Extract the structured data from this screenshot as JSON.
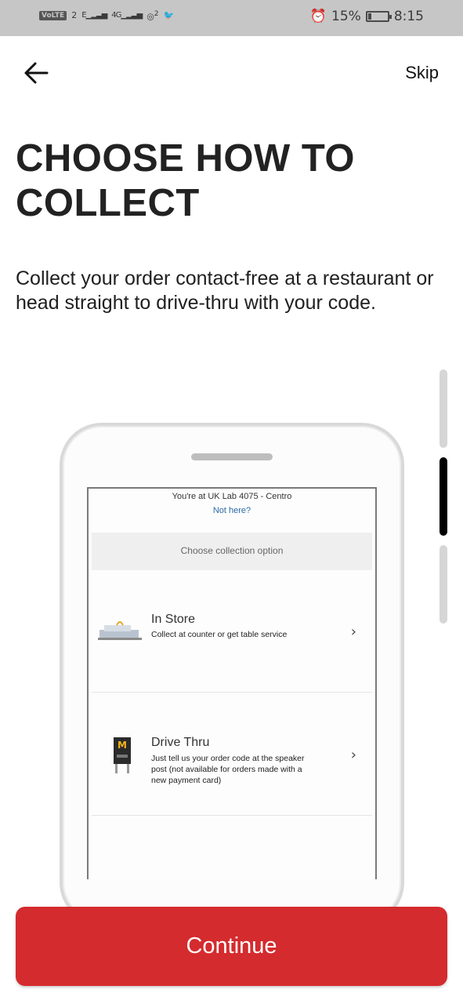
{
  "status_bar": {
    "left_volte": "VoLTE",
    "left_sim": "2",
    "left_e": "E",
    "left_4g": "4G",
    "left_hotspot_count": "2",
    "battery_percent": "15%",
    "battery_level": 0.15,
    "time": "8:15"
  },
  "header": {
    "back_icon": "arrow-left-icon",
    "skip_label": "Skip"
  },
  "title": "CHOOSE HOW TO COLLECT",
  "description": "Collect your order contact-free at a restaurant or head straight to drive-thru with your code.",
  "illustration": {
    "location_text": "You're at UK Lab 4075 - Centro",
    "not_here": "Not here?",
    "collect_label": "Choose collection option",
    "options": [
      {
        "title": "In Store",
        "subtitle": "Collect at counter or get table service",
        "icon": "store-building-icon"
      },
      {
        "title": "Drive Thru",
        "subtitle": "Just tell us your order code at the speaker post (not available for orders made with a new payment card)",
        "icon": "drive-thru-sign-icon"
      }
    ]
  },
  "continue_label": "Continue",
  "colors": {
    "brand_red": "#d42b2e",
    "status_bar": "#c6c6c6",
    "link_blue": "#2a6aa8"
  }
}
